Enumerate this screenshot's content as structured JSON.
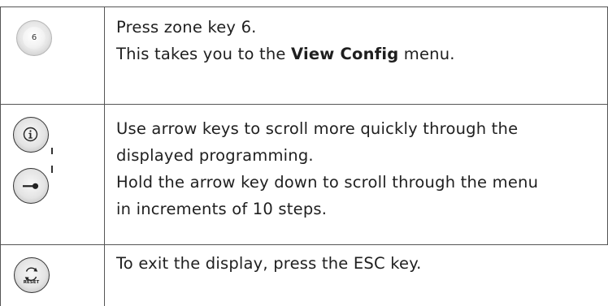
{
  "rows": [
    {
      "icon": "zone-key-6-icon",
      "key_label": "6",
      "line1": "Press zone key 6.",
      "line2_pre": "This takes you to the ",
      "line2_bold": "View Config",
      "line2_post": " menu."
    },
    {
      "icons": [
        "info-arrow-key-icon",
        "key-arrow-key-icon"
      ],
      "lines": [
        "Use arrow keys to scroll more quickly through the",
        "displayed programming.",
        "Hold the arrow key down to scroll through the menu",
        "in increments of 10 steps."
      ]
    },
    {
      "icon": "reset-esc-key-icon",
      "key_label": "RESET",
      "line1": "To exit the display, press the ESC key."
    }
  ]
}
